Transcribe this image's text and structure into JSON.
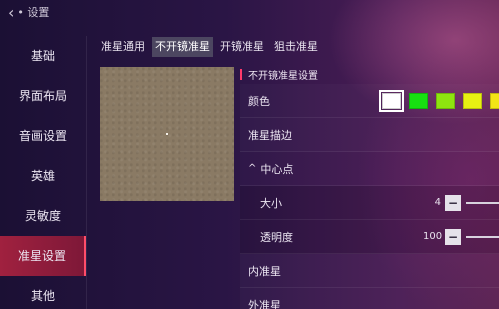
{
  "header": {
    "back_icon": "chevron-left-icon",
    "title": "• 设置"
  },
  "sidebar": {
    "items": [
      {
        "label": "基础",
        "active": false
      },
      {
        "label": "界面布局",
        "active": false
      },
      {
        "label": "音画设置",
        "active": false
      },
      {
        "label": "英雄",
        "active": false
      },
      {
        "label": "灵敏度",
        "active": false
      },
      {
        "label": "准星设置",
        "active": true
      },
      {
        "label": "其他",
        "active": false
      }
    ]
  },
  "tabs": [
    {
      "label": "准星通用",
      "active": false
    },
    {
      "label": "不开镜准星",
      "active": true
    },
    {
      "label": "开镜准星",
      "active": false
    },
    {
      "label": "狙击准星",
      "active": false
    }
  ],
  "settings": {
    "section_title": "不开镜准星设置",
    "color_label": "颜色",
    "colors": [
      "#ffffff",
      "#17e011",
      "#8ee40f",
      "#e7f012",
      "#f2e415"
    ],
    "selected_color_index": 0,
    "outline_label": "准星描边",
    "center_label": "中心点",
    "center_expanded": true,
    "size_label": "大小",
    "size_value": "4",
    "opacity_label": "透明度",
    "opacity_value": "100",
    "inner_label": "内准星",
    "outer_label": "外准星"
  }
}
